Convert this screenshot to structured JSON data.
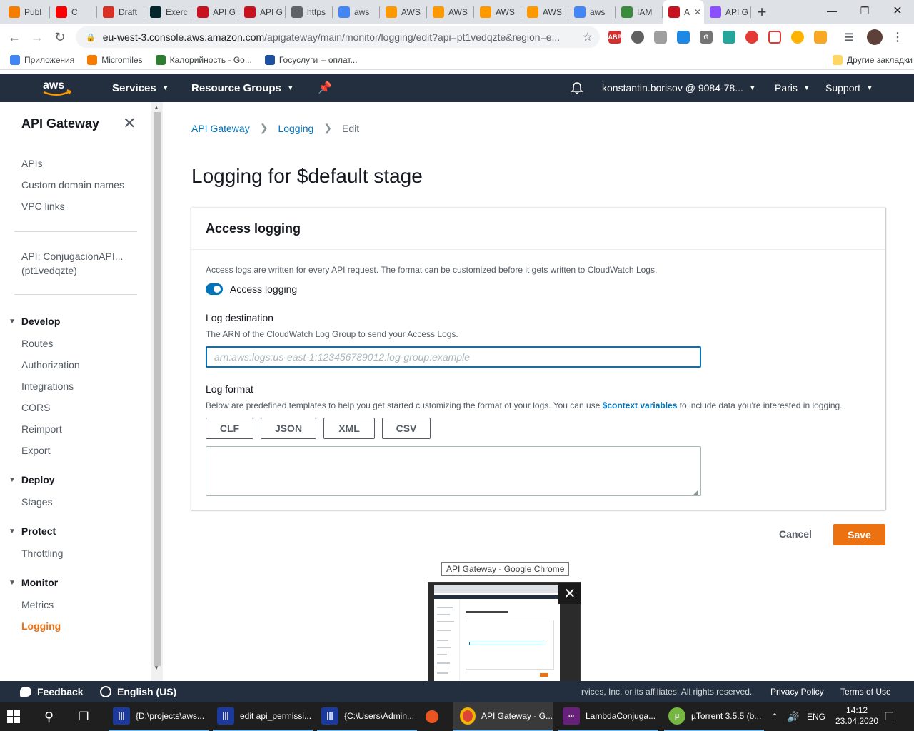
{
  "browser": {
    "tabs": [
      {
        "label": "Publ",
        "icon": "blogger-icon",
        "color": "#f57d00"
      },
      {
        "label": "C",
        "icon": "youtube-icon",
        "color": "#ff0000"
      },
      {
        "label": "Draft",
        "icon": "gmail-icon",
        "color": "#d93025"
      },
      {
        "label": "Exerc",
        "icon": "edx-icon",
        "color": "#02262b"
      },
      {
        "label": "API G",
        "icon": "api-gateway-icon",
        "color": "#c7131f"
      },
      {
        "label": "API G",
        "icon": "api-gateway-icon",
        "color": "#c7131f"
      },
      {
        "label": "https",
        "icon": "globe-icon",
        "color": "#5f6368"
      },
      {
        "label": "aws",
        "icon": "google-icon",
        "color": "#4285f4"
      },
      {
        "label": "AWS",
        "icon": "aws-box-icon",
        "color": "#ff9900"
      },
      {
        "label": "AWS",
        "icon": "aws-box-icon",
        "color": "#ff9900"
      },
      {
        "label": "AWS",
        "icon": "aws-box-icon",
        "color": "#ff9900"
      },
      {
        "label": "AWS",
        "icon": "aws-box-icon",
        "color": "#ff9900"
      },
      {
        "label": "aws",
        "icon": "google-icon",
        "color": "#4285f4"
      },
      {
        "label": "IAM",
        "icon": "iam-icon",
        "color": "#3b8a3e"
      },
      {
        "label": "A",
        "icon": "api-gateway-icon",
        "color": "#c7131f"
      },
      {
        "label": "API G",
        "icon": "cognito-icon",
        "color": "#8c4fff"
      }
    ],
    "url_host": "eu-west-3.console.aws.amazon.com",
    "url_path": "/apigateway/main/monitor/logging/edit?api=pt1vedqzte&region=e...",
    "bookmarks": [
      {
        "label": "Приложения",
        "icon": "apps-grid-icon",
        "color": "#4285f4"
      },
      {
        "label": "Micromiles",
        "icon": "micromiles-icon",
        "color": "#f57c00"
      },
      {
        "label": "Калорийность - Go...",
        "icon": "calories-icon",
        "color": "#2e7d32"
      },
      {
        "label": "Госуслуги -- оплат...",
        "icon": "gosuslugi-icon",
        "color": "#1e50a2"
      }
    ],
    "other_bookmarks": "Другие закладки"
  },
  "aws_nav": {
    "services": "Services",
    "resource_groups": "Resource Groups",
    "account": "konstantin.borisov @ 9084-78...",
    "region": "Paris",
    "support": "Support"
  },
  "sidebar": {
    "title": "API Gateway",
    "top_links": [
      "APIs",
      "Custom domain names",
      "VPC links"
    ],
    "api_name": "API: ConjugacionAPI...",
    "api_id": "(pt1vedqzte)",
    "sections": [
      {
        "title": "Develop",
        "items": [
          "Routes",
          "Authorization",
          "Integrations",
          "CORS",
          "Reimport",
          "Export"
        ]
      },
      {
        "title": "Deploy",
        "items": [
          "Stages"
        ]
      },
      {
        "title": "Protect",
        "items": [
          "Throttling"
        ]
      },
      {
        "title": "Monitor",
        "items": [
          "Metrics",
          "Logging"
        ]
      }
    ],
    "active_item": "Logging"
  },
  "breadcrumb": {
    "root": "API Gateway",
    "section": "Logging",
    "current": "Edit"
  },
  "page": {
    "title": "Logging for $default stage",
    "card_title": "Access logging",
    "access_desc": "Access logs are written for every API request. The format can be customized before it gets written to CloudWatch Logs.",
    "toggle_label": "Access logging",
    "toggle_on": true,
    "dest_label": "Log destination",
    "dest_desc": "The ARN of the CloudWatch Log Group to send your Access Logs.",
    "dest_placeholder": "arn:aws:logs:us-east-1:123456789012:log-group:example",
    "dest_value": "",
    "format_label": "Log format",
    "format_desc_before": "Below are predefined templates to help you get started customizing the format of your logs. You can use ",
    "format_desc_link": "$context variables",
    "format_desc_after": " to include data you're interested in logging.",
    "format_buttons": [
      "CLF",
      "JSON",
      "XML",
      "CSV"
    ],
    "format_value": "",
    "cancel": "Cancel",
    "save": "Save"
  },
  "tooltip": "API Gateway - Google Chrome",
  "aws_footer": {
    "feedback": "Feedback",
    "language": "English (US)",
    "copyright": "rvices, Inc. or its affiliates. All rights reserved.",
    "privacy": "Privacy Policy",
    "terms": "Terms of Use"
  },
  "taskbar": {
    "items": [
      {
        "label": "{D:\\projects\\aws...",
        "icon": "far-manager-icon"
      },
      {
        "label": "edit api_permissi...",
        "icon": "far-manager-icon"
      },
      {
        "label": "{C:\\Users\\Admin...",
        "icon": "far-manager-icon"
      },
      {
        "label": "API Gateway - G...",
        "icon": "chrome-icon"
      },
      {
        "label": "LambdaConjuga...",
        "icon": "visual-studio-icon"
      },
      {
        "label": "µTorrent 3.5.5  (b...",
        "icon": "utorrent-icon"
      }
    ],
    "lang": "ENG",
    "time": "14:12",
    "date": "23.04.2020"
  },
  "colors": {
    "aws_orange": "#ec7211",
    "aws_nav": "#232f3e",
    "link_blue": "#0073bb"
  }
}
